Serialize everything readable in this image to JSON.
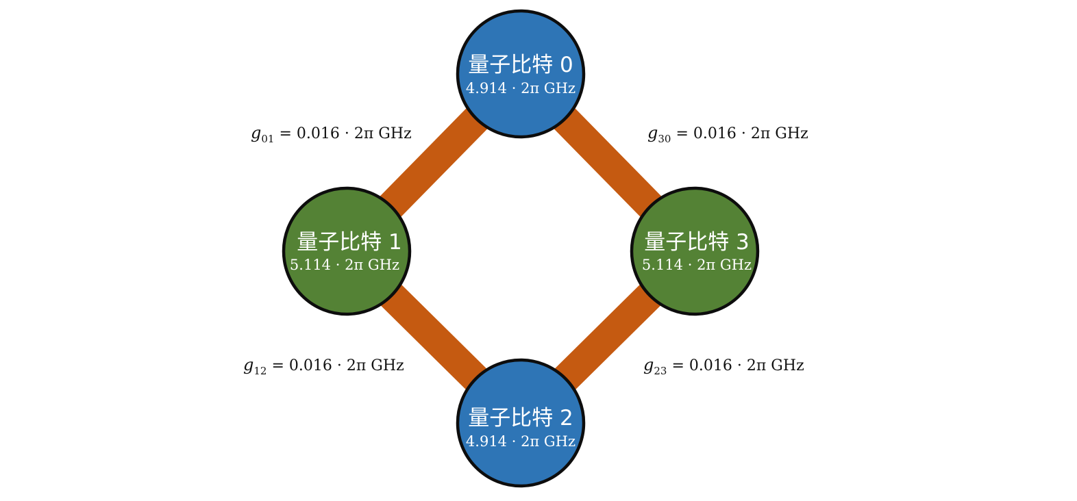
{
  "colors": {
    "blue_qubit": "#2e75b6",
    "green_qubit": "#548235",
    "coupler": "#c55a11",
    "outline": "#0d0d0d"
  },
  "qubits": [
    {
      "name": "量子比特 0",
      "frequency": "4.914 · 2π GHz",
      "color": "#2e75b6"
    },
    {
      "name": "量子比特 1",
      "frequency": "5.114 · 2π GHz",
      "color": "#548235"
    },
    {
      "name": "量子比特 2",
      "frequency": "4.914 · 2π GHz",
      "color": "#2e75b6"
    },
    {
      "name": "量子比特 3",
      "frequency": "5.114 · 2π GHz",
      "color": "#548235"
    }
  ],
  "couplings": [
    {
      "symbol": "g",
      "subscript": "01",
      "value": "= 0.016 · 2π GHz"
    },
    {
      "symbol": "g",
      "subscript": "30",
      "value": "= 0.016 · 2π GHz"
    },
    {
      "symbol": "g",
      "subscript": "12",
      "value": "= 0.016 · 2π GHz"
    },
    {
      "symbol": "g",
      "subscript": "23",
      "value": "= 0.016 · 2π GHz"
    }
  ]
}
